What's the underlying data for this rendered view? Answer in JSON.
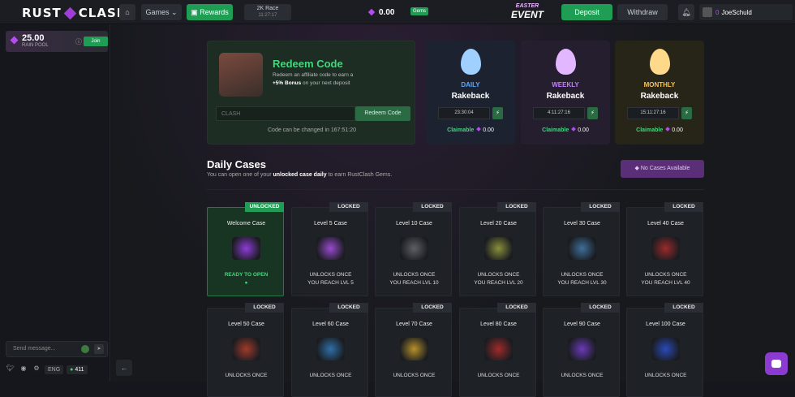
{
  "header": {
    "logo_left": "RUST",
    "logo_right": "CLASH",
    "games": "Games",
    "rewards": "Rewards",
    "race_title": "2K Race",
    "race_time": "11:27:17",
    "balance": "0.00",
    "gems_badge": "Gems",
    "easter_line1": "EASTER",
    "easter_line2": "EVENT",
    "deposit": "Deposit",
    "withdraw": "Withdraw",
    "username": "JoeSchuld",
    "user_level": "0"
  },
  "sidebar": {
    "rain_amount": "25.00",
    "rain_label": "RAIN POOL",
    "join": "Join",
    "chat_placeholder": "Send message...",
    "lang": "ENG",
    "online": "411"
  },
  "redeem": {
    "title": "Redeem Code",
    "desc1": "Redeem an affiliate code to earn a",
    "bonus": "+5% Bonus",
    "desc2": "on your next deposit",
    "placeholder": "CLASH",
    "button": "Redeem Code",
    "change_note": "Code can be changed in 167:51:20"
  },
  "rakeback": [
    {
      "period": "DAILY",
      "label": "Rakeback",
      "time": "23:30:04",
      "claim": "Claimable",
      "amount": "0.00",
      "color": "#5aa8ff",
      "egg": "#9fd0ff"
    },
    {
      "period": "WEEKLY",
      "label": "Rakeback",
      "time": "4:11:27:16",
      "claim": "Claimable",
      "amount": "0.00",
      "color": "#c77dff",
      "egg": "#e3b7ff"
    },
    {
      "period": "MONTHLY",
      "label": "Rakeback",
      "time": "15:11:27:16",
      "claim": "Claimable",
      "amount": "0.00",
      "color": "#ffc14d",
      "egg": "#ffd98a"
    }
  ],
  "daily": {
    "title": "Daily Cases",
    "sub1": "You can open one of your",
    "sub_bold": "unlocked case daily",
    "sub2": "to earn RustClash Gems.",
    "no_cases": "No Cases Available"
  },
  "cases": [
    {
      "tag": "UNLOCKED",
      "name": "Welcome Case",
      "status1": "READY TO OPEN",
      "status2": "●",
      "color": "#8e3bd6"
    },
    {
      "tag": "LOCKED",
      "name": "Level 5 Case",
      "status1": "UNLOCKS ONCE",
      "status2": "YOU REACH LVL 5",
      "color": "#9a4ad0"
    },
    {
      "tag": "LOCKED",
      "name": "Level 10 Case",
      "status1": "UNLOCKS ONCE",
      "status2": "YOU REACH LVL 10",
      "color": "#5d6066"
    },
    {
      "tag": "LOCKED",
      "name": "Level 20 Case",
      "status1": "UNLOCKS ONCE",
      "status2": "YOU REACH LVL 20",
      "color": "#8a8f3a"
    },
    {
      "tag": "LOCKED",
      "name": "Level 30 Case",
      "status1": "UNLOCKS ONCE",
      "status2": "YOU REACH LVL 30",
      "color": "#3f6f9a"
    },
    {
      "tag": "LOCKED",
      "name": "Level 40 Case",
      "status1": "UNLOCKS ONCE",
      "status2": "YOU REACH LVL 40",
      "color": "#9a2a2a"
    },
    {
      "tag": "LOCKED",
      "name": "Level 50 Case",
      "status1": "UNLOCKS ONCE",
      "status2": "",
      "color": "#a03a2a"
    },
    {
      "tag": "LOCKED",
      "name": "Level 60 Case",
      "status1": "UNLOCKS ONCE",
      "status2": "",
      "color": "#2f6fa8"
    },
    {
      "tag": "LOCKED",
      "name": "Level 70 Case",
      "status1": "UNLOCKS ONCE",
      "status2": "",
      "color": "#b8902a"
    },
    {
      "tag": "LOCKED",
      "name": "Level 80 Case",
      "status1": "UNLOCKS ONCE",
      "status2": "",
      "color": "#a02a2a"
    },
    {
      "tag": "LOCKED",
      "name": "Level 90 Case",
      "status1": "UNLOCKS ONCE",
      "status2": "",
      "color": "#6a3ab8"
    },
    {
      "tag": "LOCKED",
      "name": "Level 100 Case",
      "status1": "UNLOCKS ONCE",
      "status2": "",
      "color": "#2a4ab8"
    }
  ]
}
